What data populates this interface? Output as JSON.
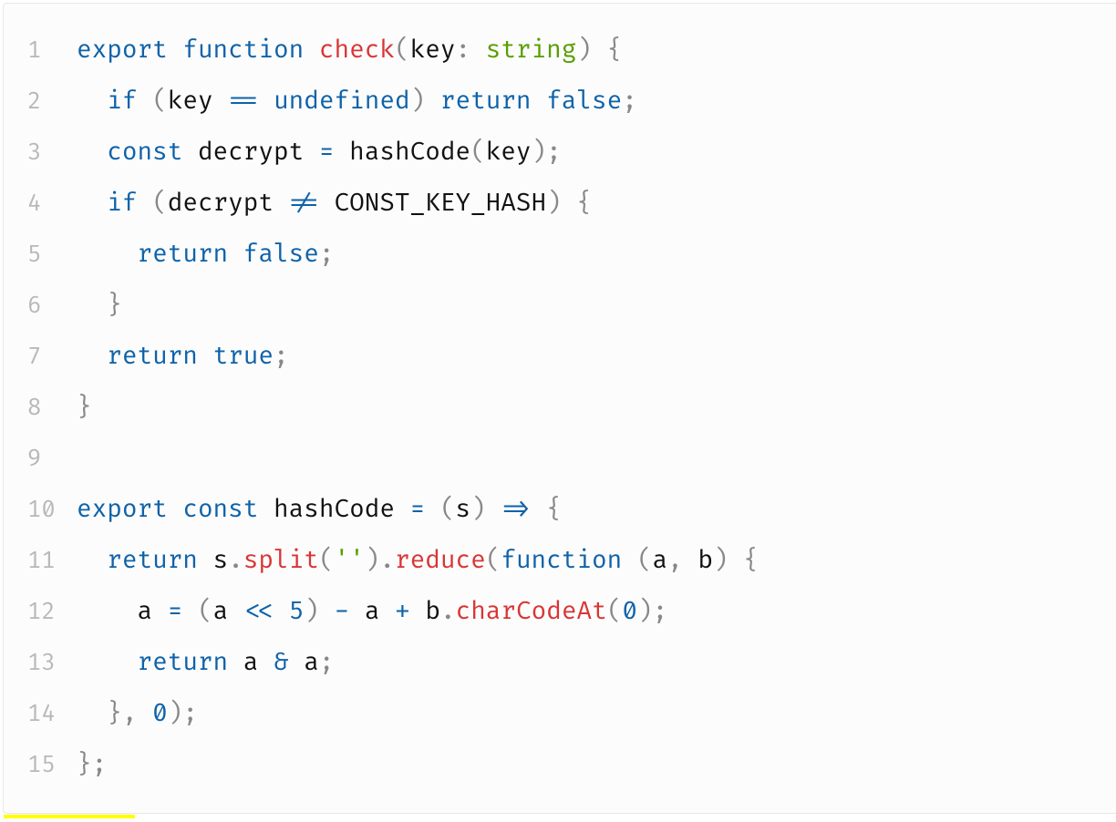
{
  "code": {
    "lines": [
      {
        "n": "1",
        "indent": "",
        "tokens": [
          {
            "c": "tk-kw",
            "t": "export"
          },
          {
            "c": "",
            "t": " "
          },
          {
            "c": "tk-kw",
            "t": "function"
          },
          {
            "c": "",
            "t": " "
          },
          {
            "c": "tk-fn",
            "t": "check"
          },
          {
            "c": "tk-punc",
            "t": "("
          },
          {
            "c": "tk-ident",
            "t": "key"
          },
          {
            "c": "tk-punc",
            "t": ":"
          },
          {
            "c": "",
            "t": " "
          },
          {
            "c": "tk-type",
            "t": "string"
          },
          {
            "c": "tk-punc",
            "t": ")"
          },
          {
            "c": "",
            "t": " "
          },
          {
            "c": "tk-punc",
            "t": "{"
          }
        ]
      },
      {
        "n": "2",
        "indent": "  ",
        "tokens": [
          {
            "c": "tk-kw",
            "t": "if"
          },
          {
            "c": "",
            "t": " "
          },
          {
            "c": "tk-punc",
            "t": "("
          },
          {
            "c": "tk-ident",
            "t": "key"
          },
          {
            "c": "",
            "t": " "
          },
          {
            "c": "tk-op",
            "t": "=="
          },
          {
            "c": "",
            "t": " "
          },
          {
            "c": "tk-undef",
            "t": "undefined"
          },
          {
            "c": "tk-punc",
            "t": ")"
          },
          {
            "c": "",
            "t": " "
          },
          {
            "c": "tk-kw",
            "t": "return"
          },
          {
            "c": "",
            "t": " "
          },
          {
            "c": "tk-undef",
            "t": "false"
          },
          {
            "c": "tk-punc",
            "t": ";"
          }
        ]
      },
      {
        "n": "3",
        "indent": "  ",
        "tokens": [
          {
            "c": "tk-kw",
            "t": "const"
          },
          {
            "c": "",
            "t": " "
          },
          {
            "c": "tk-ident",
            "t": "decrypt"
          },
          {
            "c": "",
            "t": " "
          },
          {
            "c": "tk-op",
            "t": "="
          },
          {
            "c": "",
            "t": " "
          },
          {
            "c": "tk-ident",
            "t": "hashCode"
          },
          {
            "c": "tk-punc",
            "t": "("
          },
          {
            "c": "tk-ident",
            "t": "key"
          },
          {
            "c": "tk-punc",
            "t": ")"
          },
          {
            "c": "tk-punc",
            "t": ";"
          }
        ]
      },
      {
        "n": "4",
        "indent": "  ",
        "tokens": [
          {
            "c": "tk-kw",
            "t": "if"
          },
          {
            "c": "",
            "t": " "
          },
          {
            "c": "tk-punc",
            "t": "("
          },
          {
            "c": "tk-ident",
            "t": "decrypt"
          },
          {
            "c": "",
            "t": " "
          },
          {
            "c": "tk-op",
            "t": "!="
          },
          {
            "c": "",
            "t": " "
          },
          {
            "c": "tk-upper",
            "t": "CONST_KEY_HASH"
          },
          {
            "c": "tk-punc",
            "t": ")"
          },
          {
            "c": "",
            "t": " "
          },
          {
            "c": "tk-punc",
            "t": "{"
          }
        ]
      },
      {
        "n": "5",
        "indent": "    ",
        "tokens": [
          {
            "c": "tk-kw",
            "t": "return"
          },
          {
            "c": "",
            "t": " "
          },
          {
            "c": "tk-undef",
            "t": "false"
          },
          {
            "c": "tk-punc",
            "t": ";"
          }
        ]
      },
      {
        "n": "6",
        "indent": "  ",
        "tokens": [
          {
            "c": "tk-punc",
            "t": "}"
          }
        ]
      },
      {
        "n": "7",
        "indent": "  ",
        "tokens": [
          {
            "c": "tk-kw",
            "t": "return"
          },
          {
            "c": "",
            "t": " "
          },
          {
            "c": "tk-undef",
            "t": "true"
          },
          {
            "c": "tk-punc",
            "t": ";"
          }
        ]
      },
      {
        "n": "8",
        "indent": "",
        "tokens": [
          {
            "c": "tk-punc",
            "t": "}"
          }
        ]
      },
      {
        "n": "9",
        "indent": "",
        "tokens": []
      },
      {
        "n": "10",
        "indent": "",
        "tokens": [
          {
            "c": "tk-kw",
            "t": "export"
          },
          {
            "c": "",
            "t": " "
          },
          {
            "c": "tk-kw",
            "t": "const"
          },
          {
            "c": "",
            "t": " "
          },
          {
            "c": "tk-ident",
            "t": "hashCode"
          },
          {
            "c": "",
            "t": " "
          },
          {
            "c": "tk-op",
            "t": "="
          },
          {
            "c": "",
            "t": " "
          },
          {
            "c": "tk-punc",
            "t": "("
          },
          {
            "c": "tk-ident",
            "t": "s"
          },
          {
            "c": "tk-punc",
            "t": ")"
          },
          {
            "c": "",
            "t": " "
          },
          {
            "c": "tk-op",
            "t": "=>"
          },
          {
            "c": "",
            "t": " "
          },
          {
            "c": "tk-punc",
            "t": "{"
          }
        ]
      },
      {
        "n": "11",
        "indent": "  ",
        "tokens": [
          {
            "c": "tk-kw",
            "t": "return"
          },
          {
            "c": "",
            "t": " "
          },
          {
            "c": "tk-ident",
            "t": "s"
          },
          {
            "c": "tk-dot",
            "t": "."
          },
          {
            "c": "tk-call",
            "t": "split"
          },
          {
            "c": "tk-punc",
            "t": "("
          },
          {
            "c": "tk-str",
            "t": "''"
          },
          {
            "c": "tk-punc",
            "t": ")"
          },
          {
            "c": "tk-dot",
            "t": "."
          },
          {
            "c": "tk-call",
            "t": "reduce"
          },
          {
            "c": "tk-punc",
            "t": "("
          },
          {
            "c": "tk-kw",
            "t": "function"
          },
          {
            "c": "",
            "t": " "
          },
          {
            "c": "tk-punc",
            "t": "("
          },
          {
            "c": "tk-ident",
            "t": "a"
          },
          {
            "c": "tk-punc",
            "t": ","
          },
          {
            "c": "",
            "t": " "
          },
          {
            "c": "tk-ident",
            "t": "b"
          },
          {
            "c": "tk-punc",
            "t": ")"
          },
          {
            "c": "",
            "t": " "
          },
          {
            "c": "tk-punc",
            "t": "{"
          }
        ]
      },
      {
        "n": "12",
        "indent": "    ",
        "tokens": [
          {
            "c": "tk-ident",
            "t": "a"
          },
          {
            "c": "",
            "t": " "
          },
          {
            "c": "tk-op",
            "t": "="
          },
          {
            "c": "",
            "t": " "
          },
          {
            "c": "tk-punc",
            "t": "("
          },
          {
            "c": "tk-ident",
            "t": "a"
          },
          {
            "c": "",
            "t": " "
          },
          {
            "c": "tk-op",
            "t": "<<"
          },
          {
            "c": "",
            "t": " "
          },
          {
            "c": "tk-num",
            "t": "5"
          },
          {
            "c": "tk-punc",
            "t": ")"
          },
          {
            "c": "",
            "t": " "
          },
          {
            "c": "tk-op",
            "t": "-"
          },
          {
            "c": "",
            "t": " "
          },
          {
            "c": "tk-ident",
            "t": "a"
          },
          {
            "c": "",
            "t": " "
          },
          {
            "c": "tk-op",
            "t": "+"
          },
          {
            "c": "",
            "t": " "
          },
          {
            "c": "tk-ident",
            "t": "b"
          },
          {
            "c": "tk-dot",
            "t": "."
          },
          {
            "c": "tk-call",
            "t": "charCodeAt"
          },
          {
            "c": "tk-punc",
            "t": "("
          },
          {
            "c": "tk-num",
            "t": "0"
          },
          {
            "c": "tk-punc",
            "t": ")"
          },
          {
            "c": "tk-punc",
            "t": ";"
          }
        ]
      },
      {
        "n": "13",
        "indent": "    ",
        "tokens": [
          {
            "c": "tk-kw",
            "t": "return"
          },
          {
            "c": "",
            "t": " "
          },
          {
            "c": "tk-ident",
            "t": "a"
          },
          {
            "c": "",
            "t": " "
          },
          {
            "c": "tk-op",
            "t": "&"
          },
          {
            "c": "",
            "t": " "
          },
          {
            "c": "tk-ident",
            "t": "a"
          },
          {
            "c": "tk-punc",
            "t": ";"
          }
        ]
      },
      {
        "n": "14",
        "indent": "  ",
        "tokens": [
          {
            "c": "tk-punc",
            "t": "}"
          },
          {
            "c": "tk-punc",
            "t": ","
          },
          {
            "c": "",
            "t": " "
          },
          {
            "c": "tk-num",
            "t": "0"
          },
          {
            "c": "tk-punc",
            "t": ")"
          },
          {
            "c": "tk-punc",
            "t": ";"
          }
        ]
      },
      {
        "n": "15",
        "indent": "",
        "tokens": [
          {
            "c": "tk-punc",
            "t": "}"
          },
          {
            "c": "tk-punc",
            "t": ";"
          }
        ]
      }
    ]
  }
}
